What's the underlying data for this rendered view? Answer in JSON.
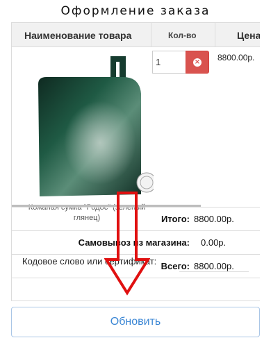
{
  "page": {
    "title": "Оформление заказа"
  },
  "table": {
    "headers": {
      "name": "Наименование товара",
      "qty": "Кол-во",
      "price": "Цена"
    },
    "items": [
      {
        "name": "Кожаная сумка \"Родос\" (зеленый глянец)",
        "qty": "1",
        "price": "8800.00р."
      }
    ]
  },
  "summary": [
    {
      "label": "Итого:",
      "value": "8800.00р."
    },
    {
      "label": "Самовывоз из магазина:",
      "value": "0.00р."
    },
    {
      "label": "Всего:",
      "value": "8800.00р."
    }
  ],
  "coupon": {
    "label": "Кодовое слово или сертификат:",
    "value": ""
  },
  "actions": {
    "update_label": "Обновить"
  },
  "icons": {
    "remove": "times-circle-icon",
    "annotation": "down-arrow-icon"
  },
  "colors": {
    "accent": "#3a86d4",
    "danger": "#d9534f",
    "annotation_arrow": "#e01010",
    "product": "#1f5a44"
  }
}
